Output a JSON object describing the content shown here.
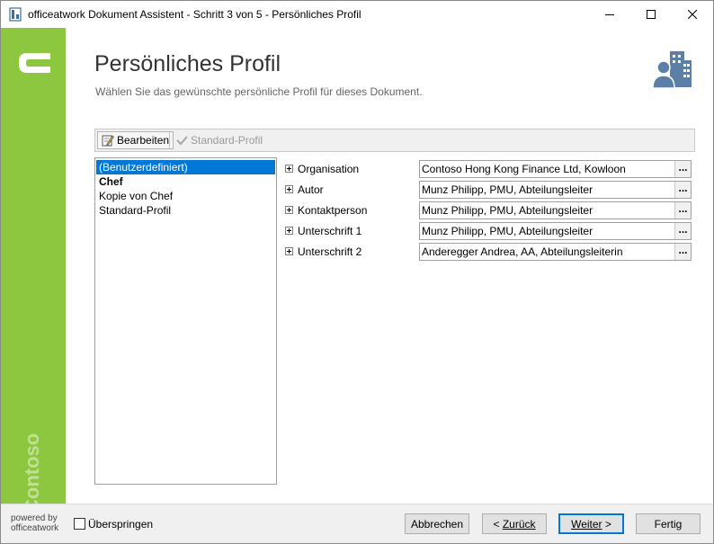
{
  "window": {
    "title": "officeatwork Dokument Assistent - Schritt 3 von 5 - Persönliches Profil",
    "controls": [
      "minimize-icon",
      "maximize-icon",
      "close-icon"
    ]
  },
  "brand": {
    "logo_letter": "C",
    "name": "Contoso",
    "color": "#8dc63f"
  },
  "header": {
    "title": "Persönliches Profil",
    "subtitle": "Wählen Sie das gewünschte persönliche Profil für dieses Dokument.",
    "icon": "people-building-icon"
  },
  "toolbar": {
    "edit_label": "Bearbeiten",
    "standard_label": "Standard-Profil"
  },
  "profiles": [
    {
      "label": "(Benutzerdefiniert)",
      "selected": true,
      "bold": false
    },
    {
      "label": "Chef",
      "selected": false,
      "bold": true
    },
    {
      "label": "Kopie von Chef",
      "selected": false,
      "bold": false
    },
    {
      "label": "Standard-Profil",
      "selected": false,
      "bold": false
    }
  ],
  "fields": [
    {
      "label": "Organisation",
      "value": "Contoso Hong Kong Finance Ltd, Kowloon"
    },
    {
      "label": "Autor",
      "value": "Munz Philipp, PMU, Abteilungsleiter"
    },
    {
      "label": "Kontaktperson",
      "value": "Munz Philipp, PMU, Abteilungsleiter"
    },
    {
      "label": "Unterschrift 1",
      "value": "Munz Philipp, PMU, Abteilungsleiter"
    },
    {
      "label": "Unterschrift 2",
      "value": "Anderegger Andrea, AA, Abteilungsleiterin"
    }
  ],
  "field_button": "...",
  "footer": {
    "powered_line1": "powered by",
    "powered_line2": "officeatwork",
    "skip_label": "Überspringen",
    "skip_checked": false,
    "cancel": "Abbrechen",
    "back_prefix": "< ",
    "back_label": "Zurück",
    "next_label": "Weiter",
    "next_suffix": " >",
    "finish": "Fertig"
  },
  "colors": {
    "accent": "#0078d7",
    "selection_bg": "#0078d7"
  }
}
